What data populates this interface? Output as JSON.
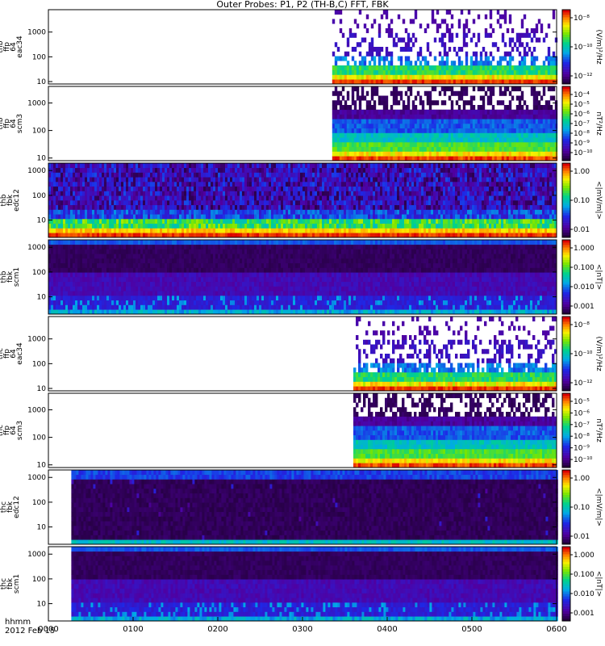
{
  "title": "Outer Probes: P1, P2 (TH-B,C) FFT, FBK",
  "footer": {
    "hhmm": "hhmm",
    "date": "2012 Feb 15"
  },
  "chart_data": {
    "type": "heatmap",
    "x_axis": {
      "ticks": [
        "0000",
        "0100",
        "0200",
        "0300",
        "0400",
        "0500",
        "0600"
      ],
      "range_hours": [
        0,
        6
      ]
    },
    "panels": [
      {
        "id": "thb-ffp-eac34",
        "ylabel": [
          "thb",
          "ffp",
          "64",
          "eac34"
        ],
        "scale": "log",
        "yticks": [
          "10",
          "100",
          "1000"
        ],
        "ylim": [
          8,
          8000
        ],
        "colorbar": {
          "label": "(V/m)²/Hz",
          "ticks": [
            "10⁻⁸",
            "10⁻¹⁰",
            "10⁻¹²"
          ]
        },
        "data_start_hour": 3.35,
        "pattern": "spiky"
      },
      {
        "id": "thb-ffp-scm3",
        "ylabel": [
          "thb",
          "ffp",
          "64",
          "scm3"
        ],
        "scale": "log",
        "yticks": [
          "10",
          "100",
          "1000"
        ],
        "ylim": [
          8,
          4000
        ],
        "colorbar": {
          "label": "nT²/Hz",
          "ticks": [
            "10⁻⁴",
            "10⁻⁵",
            "10⁻⁶",
            "10⁻⁷",
            "10⁻⁸",
            "10⁻⁹",
            "10⁻¹⁰"
          ]
        },
        "data_start_hour": 3.35,
        "pattern": "layered"
      },
      {
        "id": "thb-fbk-edc12",
        "ylabel": [
          "thb",
          "fbk",
          "edc12"
        ],
        "scale": "log",
        "yticks": [
          "10",
          "100",
          "1000"
        ],
        "ylim": [
          2,
          2000
        ],
        "colorbar": {
          "label": "<|mV/m|>",
          "ticks": [
            "1.00",
            "0.10",
            "0.01"
          ]
        },
        "data_start_hour": 0.0,
        "pattern": "edc"
      },
      {
        "id": "thb-fbk-scm1",
        "ylabel": [
          "thb",
          "fbk",
          "scm1"
        ],
        "scale": "log",
        "yticks": [
          "10",
          "100",
          "1000"
        ],
        "ylim": [
          2,
          2000
        ],
        "colorbar": {
          "label": "<|nT|>",
          "ticks": [
            "1.000",
            "0.100",
            "0.010",
            "0.001"
          ]
        },
        "data_start_hour": 0.0,
        "pattern": "scm"
      },
      {
        "id": "thc-ffp-eac34",
        "ylabel": [
          "thc",
          "ffp",
          "64",
          "eac34"
        ],
        "scale": "log",
        "yticks": [
          "10",
          "100",
          "1000"
        ],
        "ylim": [
          8,
          8000
        ],
        "colorbar": {
          "label": "(V/m)²/Hz",
          "ticks": [
            "10⁻⁸",
            "10⁻¹⁰",
            "10⁻¹²"
          ]
        },
        "data_start_hour": 3.6,
        "pattern": "spiky"
      },
      {
        "id": "thc-ffp-scm3",
        "ylabel": [
          "thc",
          "ffp",
          "64",
          "scm3"
        ],
        "scale": "log",
        "yticks": [
          "10",
          "100",
          "1000"
        ],
        "ylim": [
          8,
          4000
        ],
        "colorbar": {
          "label": "nT²/Hz",
          "ticks": [
            "10⁻⁵",
            "10⁻⁶",
            "10⁻⁷",
            "10⁻⁸",
            "10⁻⁹",
            "10⁻¹⁰"
          ]
        },
        "data_start_hour": 3.6,
        "pattern": "layered"
      },
      {
        "id": "thc-fbk-edc12",
        "ylabel": [
          "thc",
          "fbk",
          "edc12"
        ],
        "scale": "log",
        "yticks": [
          "10",
          "100",
          "1000"
        ],
        "ylim": [
          2,
          2000
        ],
        "colorbar": {
          "label": "<|mV/m|>",
          "ticks": [
            "1.00",
            "0.10",
            "0.01"
          ]
        },
        "data_start_hour": 0.27,
        "pattern": "dark"
      },
      {
        "id": "thc-fbk-scm1",
        "ylabel": [
          "thc",
          "fbk",
          "scm1"
        ],
        "scale": "log",
        "yticks": [
          "10",
          "100",
          "1000"
        ],
        "ylim": [
          2,
          2000
        ],
        "colorbar": {
          "label": "<|nT|>",
          "ticks": [
            "1.000",
            "0.100",
            "0.010",
            "0.001"
          ]
        },
        "data_start_hour": 0.27,
        "pattern": "scm"
      }
    ]
  }
}
